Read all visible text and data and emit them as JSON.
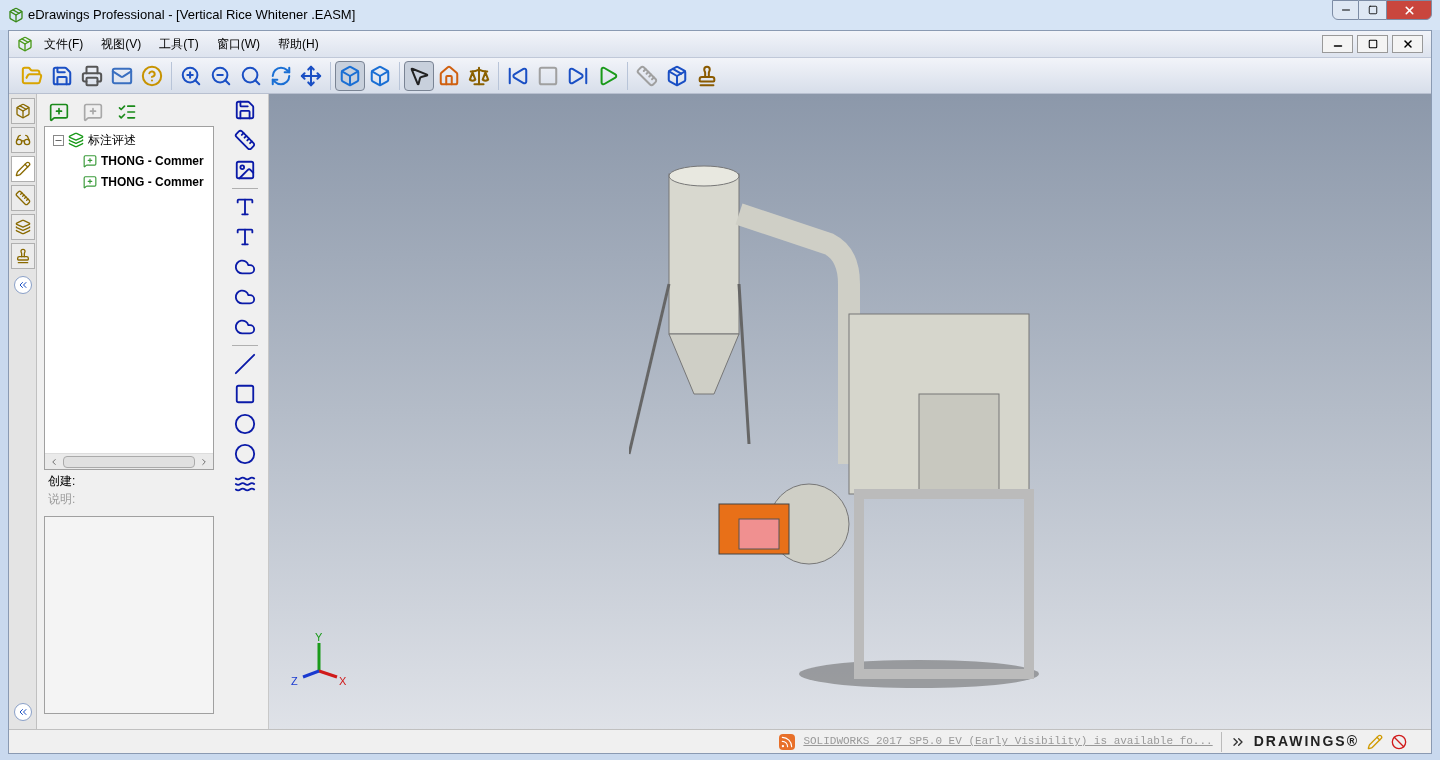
{
  "window": {
    "title": "eDrawings Professional - [Vertical Rice Whitener .EASM]"
  },
  "menu": [
    "文件(F)",
    "视图(V)",
    "工具(T)",
    "窗口(W)",
    "帮助(H)"
  ],
  "toolbar": [
    [
      {
        "pressed": false,
        "disabled": false
      },
      {
        "pressed": false,
        "disabled": false
      },
      {
        "pressed": false,
        "disabled": false
      },
      {
        "pressed": false,
        "disabled": false
      },
      {
        "pressed": false,
        "disabled": false
      }
    ],
    [
      {
        "pressed": false,
        "disabled": false
      },
      {
        "pressed": false,
        "disabled": false
      },
      {
        "pressed": false,
        "disabled": false
      },
      {
        "pressed": false,
        "disabled": false
      },
      {
        "pressed": false,
        "disabled": false
      }
    ],
    [
      {
        "pressed": true,
        "disabled": false
      },
      {
        "pressed": false,
        "disabled": false
      }
    ],
    [
      {
        "pressed": true,
        "disabled": false
      },
      {
        "pressed": false,
        "disabled": false
      },
      {
        "pressed": false,
        "disabled": false
      }
    ],
    [
      {
        "pressed": false,
        "disabled": false
      },
      {
        "pressed": false,
        "disabled": true
      },
      {
        "pressed": false,
        "disabled": false
      },
      {
        "pressed": false,
        "disabled": false
      }
    ],
    [
      {
        "pressed": false,
        "disabled": true
      },
      {
        "pressed": false,
        "disabled": false
      },
      {
        "pressed": false,
        "disabled": false
      }
    ]
  ],
  "side_tabs": [
    {
      "selected": false
    },
    {
      "selected": false
    },
    {
      "selected": true
    },
    {
      "selected": false
    },
    {
      "selected": false
    },
    {
      "selected": false
    }
  ],
  "panel_actions": [
    {
      "disabled": false
    },
    {
      "disabled": true
    },
    {
      "disabled": false
    }
  ],
  "tree": {
    "label": "标注评述",
    "expanded": true,
    "children": [
      {
        "label": "THONG - Commer"
      },
      {
        "label": "THONG - Commer"
      }
    ]
  },
  "details": {
    "created_label": "创建:",
    "description_label": "说明:"
  },
  "axes": {
    "x": "X",
    "y": "Y",
    "z": "Z"
  },
  "status_bar": {
    "news": "SOLIDWORKS 2017 SP5.0 EV (Early Visibility) is available fo...",
    "brand": "DRAWINGS®"
  }
}
